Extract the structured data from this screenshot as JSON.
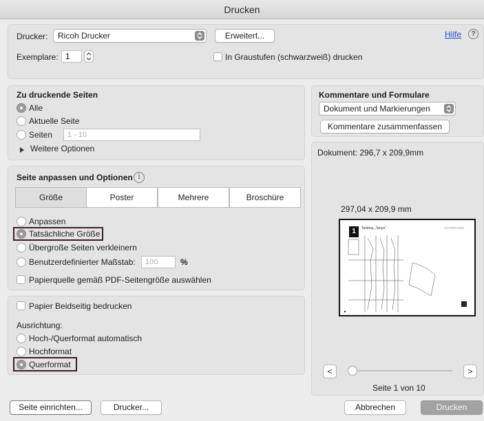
{
  "window": {
    "title": "Drucken"
  },
  "printer": {
    "label": "Drucker:",
    "value": "Ricoh Drucker",
    "advanced_button": "Erweitert...",
    "help_link": "Hilfe",
    "copies_label": "Exemplare:",
    "copies_value": "1",
    "grayscale_label": "In Graustufen (schwarzweiß) drucken"
  },
  "pages": {
    "title": "Zu druckende Seiten",
    "options": [
      "Alle",
      "Aktuelle Seite",
      "Seiten"
    ],
    "selected": "Alle",
    "range_placeholder": "1 - 10",
    "more_options": "Weitere Optionen"
  },
  "fit": {
    "title": "Seite anpassen und Optionen",
    "tabs": [
      "Größe",
      "Poster",
      "Mehrere",
      "Broschüre"
    ],
    "selected_tab": "Größe",
    "options": [
      "Anpassen",
      "Tatsächliche Größe",
      "Übergroße Seiten verkleinern",
      "Benutzerdefinierter Maßstab:"
    ],
    "selected": "Tatsächliche Größe",
    "scale_value": "100",
    "scale_unit": "%",
    "paper_source_label": "Papierquelle gemäß PDF-Seitengröße auswählen"
  },
  "duplex": {
    "label": "Papier Beidseitig bedrucken",
    "orientation_label": "Ausrichtung:",
    "options": [
      "Hoch-/Querformat automatisch",
      "Hochformat",
      "Querformat"
    ],
    "selected": "Querformat"
  },
  "comments": {
    "title": "Kommentare und Formulare",
    "value": "Dokument und Markierungen",
    "summarize_button": "Kommentare zusammenfassen"
  },
  "preview": {
    "document_size": "Dokument: 296,7 x 209,9mm",
    "page_size": "297,04 x 209,9 mm",
    "thumb_number": "1",
    "thumb_title": "Tanktop „Tanya“",
    "thumb_brand": "schnittmuster",
    "prev_button": "<",
    "next_button": ">",
    "page_indicator": "Seite 1 von 10"
  },
  "footer": {
    "page_setup": "Seite einrichten...",
    "printer": "Drucker...",
    "cancel": "Abbrechen",
    "print": "Drucken"
  }
}
